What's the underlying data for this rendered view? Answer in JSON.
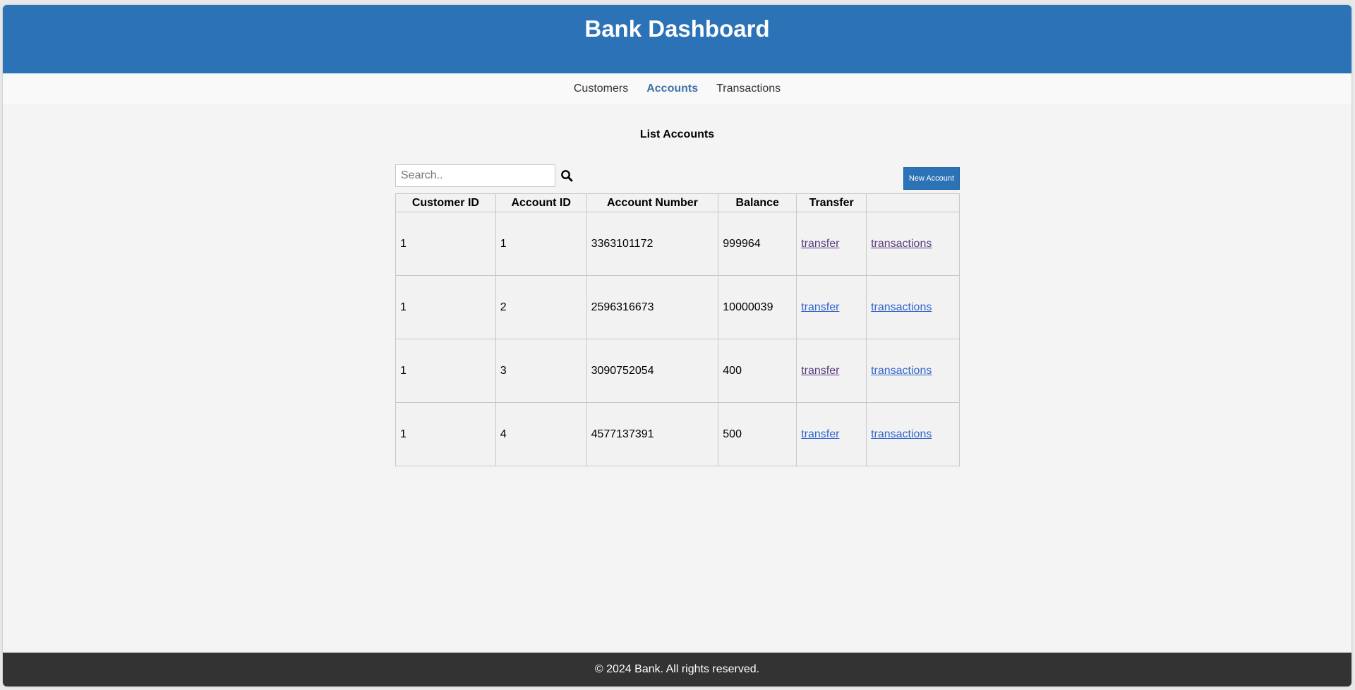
{
  "header": {
    "title": "Bank Dashboard"
  },
  "nav": {
    "items": [
      {
        "label": "Customers",
        "active": false
      },
      {
        "label": "Accounts",
        "active": true
      },
      {
        "label": "Transactions",
        "active": false
      }
    ]
  },
  "main": {
    "title": "List Accounts",
    "search": {
      "placeholder": "Search..",
      "value": ""
    },
    "new_account_label": "New Account",
    "table": {
      "columns": [
        "Customer ID",
        "Account ID",
        "Account Number",
        "Balance",
        "Transfer",
        ""
      ],
      "rows": [
        {
          "customer_id": "1",
          "account_id": "1",
          "account_number": "3363101172",
          "balance": "999964",
          "transfer": "transfer",
          "transactions": "transactions"
        },
        {
          "customer_id": "1",
          "account_id": "2",
          "account_number": "2596316673",
          "balance": "10000039",
          "transfer": "transfer",
          "transactions": "transactions"
        },
        {
          "customer_id": "1",
          "account_id": "3",
          "account_number": "3090752054",
          "balance": "400",
          "transfer": "transfer",
          "transactions": "transactions"
        },
        {
          "customer_id": "1",
          "account_id": "4",
          "account_number": "4577137391",
          "balance": "500",
          "transfer": "transfer",
          "transactions": "transactions"
        }
      ]
    }
  },
  "footer": {
    "text": "© 2024 Bank. All rights reserved."
  },
  "colors": {
    "primary": "#2b72b7",
    "footer": "#333333",
    "active_nav": "#3f73a5"
  },
  "icons": {
    "search": "search-icon"
  }
}
